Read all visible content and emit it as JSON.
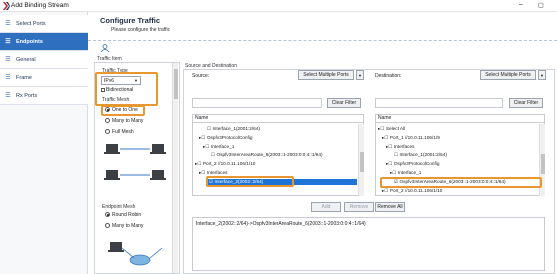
{
  "window": {
    "title": "Add Binding Stream",
    "minimize": "–",
    "maximize": "◻"
  },
  "sidebar": {
    "items": [
      {
        "label": "Select Ports",
        "icon": "list-icon",
        "active": false
      },
      {
        "label": "Endpoints",
        "icon": "list-icon",
        "active": true
      },
      {
        "label": "General",
        "icon": "list-icon",
        "active": false
      },
      {
        "label": "Frame",
        "icon": "list-icon",
        "active": false
      },
      {
        "label": "Rx Ports",
        "icon": "list-icon",
        "active": false
      }
    ]
  },
  "header": {
    "title": "Configure Traffic",
    "subtitle": "Please configure the traffic"
  },
  "traffic_item": {
    "label": "Traffic Item",
    "traffic_type_label": "Traffic Type",
    "traffic_type_value": "IPv6",
    "bidirectional_label": "Bidirectional",
    "mesh_label": "Traffic Mesh",
    "mesh_options": [
      "One to One",
      "Many to Many",
      "Full Mesh"
    ],
    "mesh_selected": "One to One",
    "endpoint_mesh_label": "Endpoint Mesh",
    "endpoint_options": [
      "Round Robin",
      "Many to Many"
    ],
    "endpoint_selected": "Round Robin"
  },
  "source_destination": {
    "label": "Source and Destination",
    "source_label": "Source:",
    "destination_label": "Destination:",
    "select_multiple_label": "Select Multiple Ports",
    "clear_filter_label": "Clear Filter",
    "name_header": "Name",
    "source_tree": [
      "☐ Interface_1(2001:2/64)",
      "▸☐ Ospfv3ProtocolConfig",
      "▸☐ Interface_1",
      "☐ Ospfv3InterAreaRoute_6(2003::1-2003:0:0:4::1/64)",
      "▸☐ Port_2 //10.0.11.106/1/10",
      "▸☐ Interfaces",
      "☑ Interface_2(2002::2/64)"
    ],
    "destination_tree": [
      "▸☐ Select All",
      "▸☐ Port_1 //10.0.11.106/1/9",
      "▸☐ Interfaces",
      "☐ Interface_1(2001:2/64)",
      "▸☐ Ospfv3ProtocolConfig",
      "▸☐ Interface_1",
      "☑ Ospfv3InterAreaRoute_6(2003::1-2003:0:0:4::1/64)",
      "▸☐ Port_2 //10.0.11.106/1/10"
    ],
    "add_label": "Add",
    "remove_label": "Remove",
    "remove_all_label": "Remove All",
    "result_text": "Interface_2(2002::2/64)->Ospfv3InterAreaRoute_6(2003::1-2003:0:0:4::1/64)"
  }
}
